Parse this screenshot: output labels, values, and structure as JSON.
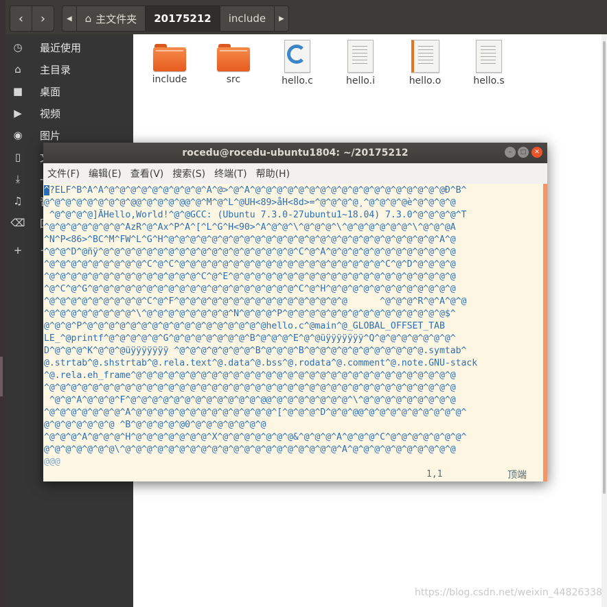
{
  "file_manager": {
    "breadcrumbs": [
      "主文件夹",
      "20175212",
      "include"
    ],
    "sidebar": [
      {
        "icon": "recent-icon",
        "glyph": "◷",
        "label": "最近使用"
      },
      {
        "icon": "home-icon",
        "glyph": "⌂",
        "label": "主目录"
      },
      {
        "icon": "desktop-icon",
        "glyph": "■",
        "label": "桌面"
      },
      {
        "icon": "video-icon",
        "glyph": "▶",
        "label": "视频"
      },
      {
        "icon": "camera-icon",
        "glyph": "◉",
        "label": "图片"
      },
      {
        "icon": "document-icon",
        "glyph": "▯",
        "label": "文"
      },
      {
        "icon": "download-icon",
        "glyph": "⤓",
        "label": "-"
      },
      {
        "icon": "music-icon",
        "glyph": "♫",
        "label": "音"
      },
      {
        "icon": "trash-icon",
        "glyph": "⌫",
        "label": "回"
      },
      {
        "icon": "plus-icon",
        "glyph": "+",
        "label": "+"
      }
    ],
    "files": [
      {
        "name": "include",
        "type": "folder"
      },
      {
        "name": "src",
        "type": "folder"
      },
      {
        "name": "hello.c",
        "type": "c-source"
      },
      {
        "name": "hello.i",
        "type": "text"
      },
      {
        "name": "hello.o",
        "type": "object"
      },
      {
        "name": "hello.s",
        "type": "text"
      }
    ]
  },
  "terminal": {
    "title": "rocedu@rocedu-ubuntu1804: ~/20175212",
    "menu": [
      "文件(F)",
      "编辑(E)",
      "查看(V)",
      "搜索(S)",
      "终端(T)",
      "帮助(H)"
    ],
    "cursor_char": "^",
    "lines": [
      "?ELF^B^A^A^@^@^@^@^@^@^@^@^@^A^@>^@^A^@^@^@^@^@^@^@^@^@^@^@^@^@^@^@^@^@^@Ð^B^",
      "@^@^@^@^@^@^@^@^@@^@^@^@^@@^@^M^@^L^@UH<89>åH<8d>=^@^@^@^@¸^@^@^@^@è^@^@^@^@",
      " ^@^@^@^@]ÃHello,World!^@^@GCC: (Ubuntu 7.3.0-27ubuntu1~18.04) 7.3.0^@^@^@^@^T",
      "^@^@^@^@^@^@^@^AzR^@^Ax^P^A^[^L^G^H<90>^A^@^@^\\^@^@^@^\\^@^@^@^@^@^@^\\^@^@^@A",
      "^N^P<86>^BC^M^FW^L^G^H^@^@^@^@^@^@^@^@^@^@^@^@^@^@^@^@^@^@^@^@^@^@^@^@^@^A^@",
      "^@^@^D^@ñÿ^@^@^@^@^@^@^@^@^@^@^@^@^@^@^@^@^@^@^C^@^A^@^@^@^@^@^@^@^@^@^@^@^@",
      "^@^@^@^@^@^@^@^@^@^C^@^C^@^@^@^@^@^@^@^@^@^@^@^@^@^@^@^@^@^@^@^C^@^D^@^@^@^@",
      "^@^@^@^@^@^@^@^@^@^@^@^@^@^@^C^@^E^@^@^@^@^@^@^@^@^@^@^@^@^@^@^@^@^@^@^@^@^@",
      "^@^C^@^G^@^@^@^@^@^@^@^@^@^@^@^@^@^@^@^@^@^@^@^C^@^H^@^@^@^@^@^@^@^@^@^@^@^@",
      "^@^@^@^@^@^@^@^@^@^C^@^F^@^@^@^@^@^@^@^@^@^@^@^@^@^@^@^@      ^@^@^@^R^@^A^@^@",
      "^@^@^@^@^@^@^@^@^\\^@^@^@^@^@^@^@^@^N^@^@^@^P^@^@^@^@^@^@^@^@^@^@^@^@^@^@^@$^",
      "@^@^@^P^@^@^@^@^@^@^@^@^@^@^@^@^@^@^@^@^@hello.c^@main^@_GLOBAL_OFFSET_TAB",
      "LE_^@printf^@^@^@^@^@^G^@^@^@^@^@^@^@^B^@^@^@^E^@^@üÿÿÿÿÿÿÿ^Q^@^@^@^@^@^@^@^",
      "D^@^@^@^K^@^@^@üÿÿÿÿÿÿÿ ^@^@^@^@^@^@^@^B^@^@^@^B^@^@^@^@^@^@^@^@^@^@^@.symtab^",
      "@.strtab^@.shstrtab^@.rela.text^@.data^@.bss^@.rodata^@.comment^@.note.GNU-stack",
      "^@.rela.eh_frame^@^@^@^@^@^@^@^@^@^@^@^@^@^@^@^@^@^@^@^@^@^@^@^@^@^@^@^@^@^@",
      "^@^@^@^@^@^@^@^@^@^@^@^@^@^@^@^@^@^@^@^@^@^@^@^@^@^@^@^@^@^@^@^@^@^@^@^@^@^@",
      " ^@^@^A^@^@^@^F^@^@^@^@^@^@^@^@^@^@^@^@^@@^@^@^@^@^@^@^@^\\^@^@^@^@^@^@^@^@^@",
      "^@^@^@^@^@^@^@^A^@^@^@^@^@^@^@^@^@^@^@^@^@^[^@^@^@^D^@^@^@@^@^@^@^@^@^@^@^@^@^",
      "@^@^@^@^@^@^@ ^B^@^@^@^@^@0^@^@^@^@^@^@^@",
      "^@^@^@^A^@^@^@^H^@^@^@^@^@^@^@^X^@^@^@^@^@^@^@&^@^@^@^A^@^@^@^C^@^@^@^@^@^@^@^",
      "@^@^@^@^@^@^@\\^@^@^@^@^@^@^@^@^@^@^@^@^@^@^@^@^@^@^@^@^A^@^@^@^@^@^@^@^@^@^@"
    ],
    "end_of_buffer": "@@@",
    "status_position": "1,1",
    "status_where": "顶端"
  },
  "watermark": "https://blog.csdn.net/weixin_44826338"
}
